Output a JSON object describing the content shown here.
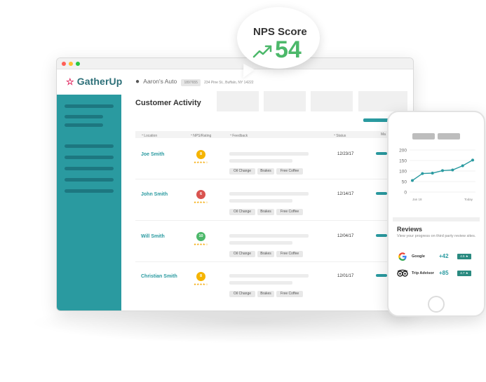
{
  "nps": {
    "label": "NPS Score",
    "value": "54"
  },
  "app": {
    "logo": "GatherUp",
    "location_name": "Aaron's Auto",
    "location_id": "1897655",
    "location_address": "234 Pine St., Buffalo, NY 14222",
    "page_title": "Customer Activity"
  },
  "table": {
    "headers": {
      "location": "Location",
      "nps": "NPS/Rating",
      "feedback": "Feedback",
      "status": "Status",
      "more": "Ma"
    },
    "rows": [
      {
        "name": "Joe Smith",
        "score": "8",
        "score_color": "#f5b400",
        "date": "12/23/17",
        "stars": "★★★★☆",
        "tags": [
          "Oil Change",
          "Brakes",
          "Free Coffee"
        ]
      },
      {
        "name": "John Smith",
        "score": "6",
        "score_color": "#d9534f",
        "date": "12/14/17",
        "stars": "★★★★☆",
        "tags": [
          "Oil Change",
          "Brakes",
          "Free Coffee"
        ]
      },
      {
        "name": "Will Smith",
        "score": "10",
        "score_color": "#4cb86a",
        "date": "12/04/17",
        "stars": "★★★★☆",
        "tags": [
          "Oil Change",
          "Brakes",
          "Free Coffee"
        ]
      },
      {
        "name": "Christian Smith",
        "score": "8",
        "score_color": "#f5b400",
        "date": "12/01/17",
        "stars": "★★★★☆",
        "tags": [
          "Oil Change",
          "Brakes",
          "Free Coffee"
        ]
      }
    ]
  },
  "chart_data": {
    "type": "line",
    "x": [
      "Jan 18",
      "",
      "",
      "",
      "",
      "",
      "Today"
    ],
    "x_tick_labels": [
      "Jan 18",
      "Today"
    ],
    "series": [
      {
        "values": [
          55,
          88,
          90,
          102,
          105,
          125,
          152
        ]
      }
    ],
    "y_ticks": [
      0,
      50,
      100,
      150,
      200
    ],
    "ylim": [
      0,
      200
    ],
    "color": "#2a9aa0"
  },
  "reviews": {
    "title": "Reviews",
    "subtitle": "View your progress on third party review sites.",
    "items": [
      {
        "name": "Google",
        "delta": "+42",
        "rating": "4.5 ★",
        "icon": "google-icon"
      },
      {
        "name": "Trip Advisor",
        "delta": "+85",
        "rating": "4.7 ★",
        "icon": "tripadvisor-icon"
      }
    ]
  },
  "colors": {
    "accent": "#2a9aa0",
    "nps_green": "#4cb86a",
    "sidebar": "#2a9aa0"
  }
}
